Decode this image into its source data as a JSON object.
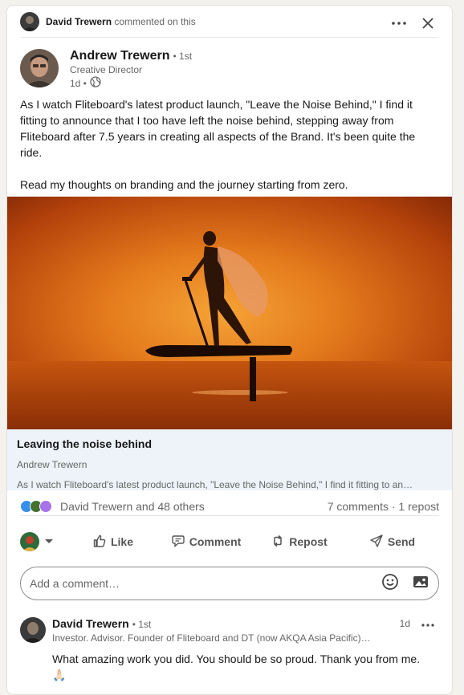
{
  "context": {
    "actor": "David Trewern",
    "action": "commented on this"
  },
  "post": {
    "author_name": "Andrew Trewern",
    "degree": "• 1st",
    "title": "Creative Director",
    "time": "1d •",
    "paragraphs": [
      "As I watch Fliteboard's latest product launch, \"Leave the Noise Behind,\" I find it fitting to announce that I too have left the noise behind, stepping away from Fliteboard after 7.5 years in creating all aspects of the Brand. It's been quite the ride.",
      "Read my thoughts on branding and the journey starting from zero."
    ]
  },
  "article": {
    "title": "Leaving the noise behind",
    "author": "Andrew Trewern",
    "snippet": "As I watch Fliteboard's latest product launch, \"Leave the Noise Behind,\" I find it fitting to an…"
  },
  "social": {
    "reactors_text": "David Trewern and 48 others",
    "counts_text": "7 comments · 1 repost"
  },
  "actions": {
    "like": "Like",
    "comment": "Comment",
    "repost": "Repost",
    "send": "Send"
  },
  "comment_box": {
    "placeholder": "Add a comment…"
  },
  "comment": {
    "author_name": "David Trewern",
    "degree": "• 1st",
    "headline": "Investor. Advisor. Founder of Fliteboard and DT (now AKQA Asia Pacific)…",
    "time": "1d",
    "body": "What amazing work you did. You should be so proud. Thank you from me.",
    "emoji": "🙏🏻"
  },
  "colors": {
    "like_blue": "#378fe9",
    "celebrate_green": "#44712e",
    "support_purple": "#a872e8",
    "article_bg": "#edf3f8"
  }
}
